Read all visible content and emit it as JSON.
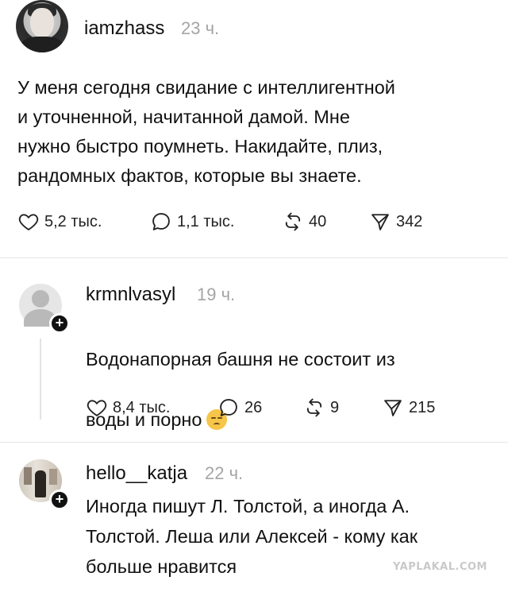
{
  "post": {
    "username": "iamzhass",
    "time": "23 ч.",
    "text": "У меня сегодня свидание с интеллигентной\nи уточненной, начитанной дамой. Мне\nнужно быстро поумнеть. Накидайте, плиз,\nрандомных фактов, которые вы знаете.",
    "likes": "5,2 тыс.",
    "replies": "1,1 тыс.",
    "reposts": "40",
    "shares": "342"
  },
  "comments": [
    {
      "username": "krmnlvasyl",
      "time": "19 ч.",
      "text_line1": "Водонапорная башня не состоит из",
      "text_line2": "воды и порно",
      "emoji": "pensive-face",
      "likes": "8,4 тыс.",
      "replies": "26",
      "reposts": "9",
      "shares": "215"
    },
    {
      "username": "hello__katja",
      "time": "22 ч.",
      "text": "Иногда пишут Л. Толстой, а иногда А.\nТолстой. Леша или Алексей - кому как\nбольше нравится"
    }
  ],
  "watermark": "YAPLAKAL.COM",
  "icons": {
    "like": "heart-icon",
    "reply": "speech-bubble-icon",
    "repost": "repost-icon",
    "share": "send-icon",
    "follow": "plus-icon"
  },
  "colors": {
    "text": "#111111",
    "muted": "#a5a5a5",
    "divider": "#e6e6e6"
  }
}
